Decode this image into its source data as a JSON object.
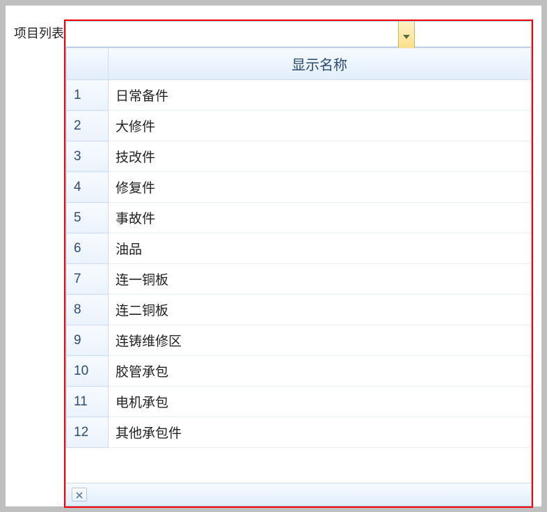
{
  "field_label": "项目列表",
  "combo": {
    "value": ""
  },
  "grid": {
    "header": {
      "num_col": "",
      "name_col": "显示名称"
    },
    "rows": [
      {
        "num": "1",
        "name": "日常备件"
      },
      {
        "num": "2",
        "name": "大修件"
      },
      {
        "num": "3",
        "name": "技改件"
      },
      {
        "num": "4",
        "name": "修复件"
      },
      {
        "num": "5",
        "name": "事故件"
      },
      {
        "num": "6",
        "name": "油品"
      },
      {
        "num": "7",
        "name": "连一铜板"
      },
      {
        "num": "8",
        "name": "连二铜板"
      },
      {
        "num": "9",
        "name": "连铸维修区"
      },
      {
        "num": "10",
        "name": "胶管承包"
      },
      {
        "num": "11",
        "name": "电机承包"
      },
      {
        "num": "12",
        "name": "其他承包件"
      }
    ]
  }
}
